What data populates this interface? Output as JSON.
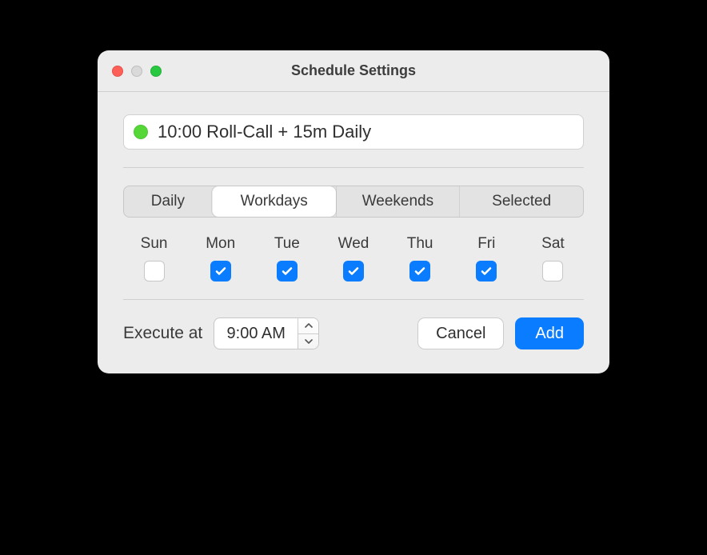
{
  "window": {
    "title": "Schedule Settings"
  },
  "preset": {
    "status_color": "#54d737",
    "text": "10:00 Roll-Call + 15m Daily"
  },
  "segments": {
    "daily": "Daily",
    "workdays": "Workdays",
    "weekends": "Weekends",
    "selected": "Selected",
    "active": "workdays"
  },
  "days": [
    {
      "abbr": "Sun",
      "checked": false
    },
    {
      "abbr": "Mon",
      "checked": true
    },
    {
      "abbr": "Tue",
      "checked": true
    },
    {
      "abbr": "Wed",
      "checked": true
    },
    {
      "abbr": "Thu",
      "checked": true
    },
    {
      "abbr": "Fri",
      "checked": true
    },
    {
      "abbr": "Sat",
      "checked": false
    }
  ],
  "execute": {
    "label": "Execute at",
    "time": "9:00 AM"
  },
  "buttons": {
    "cancel": "Cancel",
    "add": "Add"
  },
  "colors": {
    "accent": "#0a7cff"
  }
}
